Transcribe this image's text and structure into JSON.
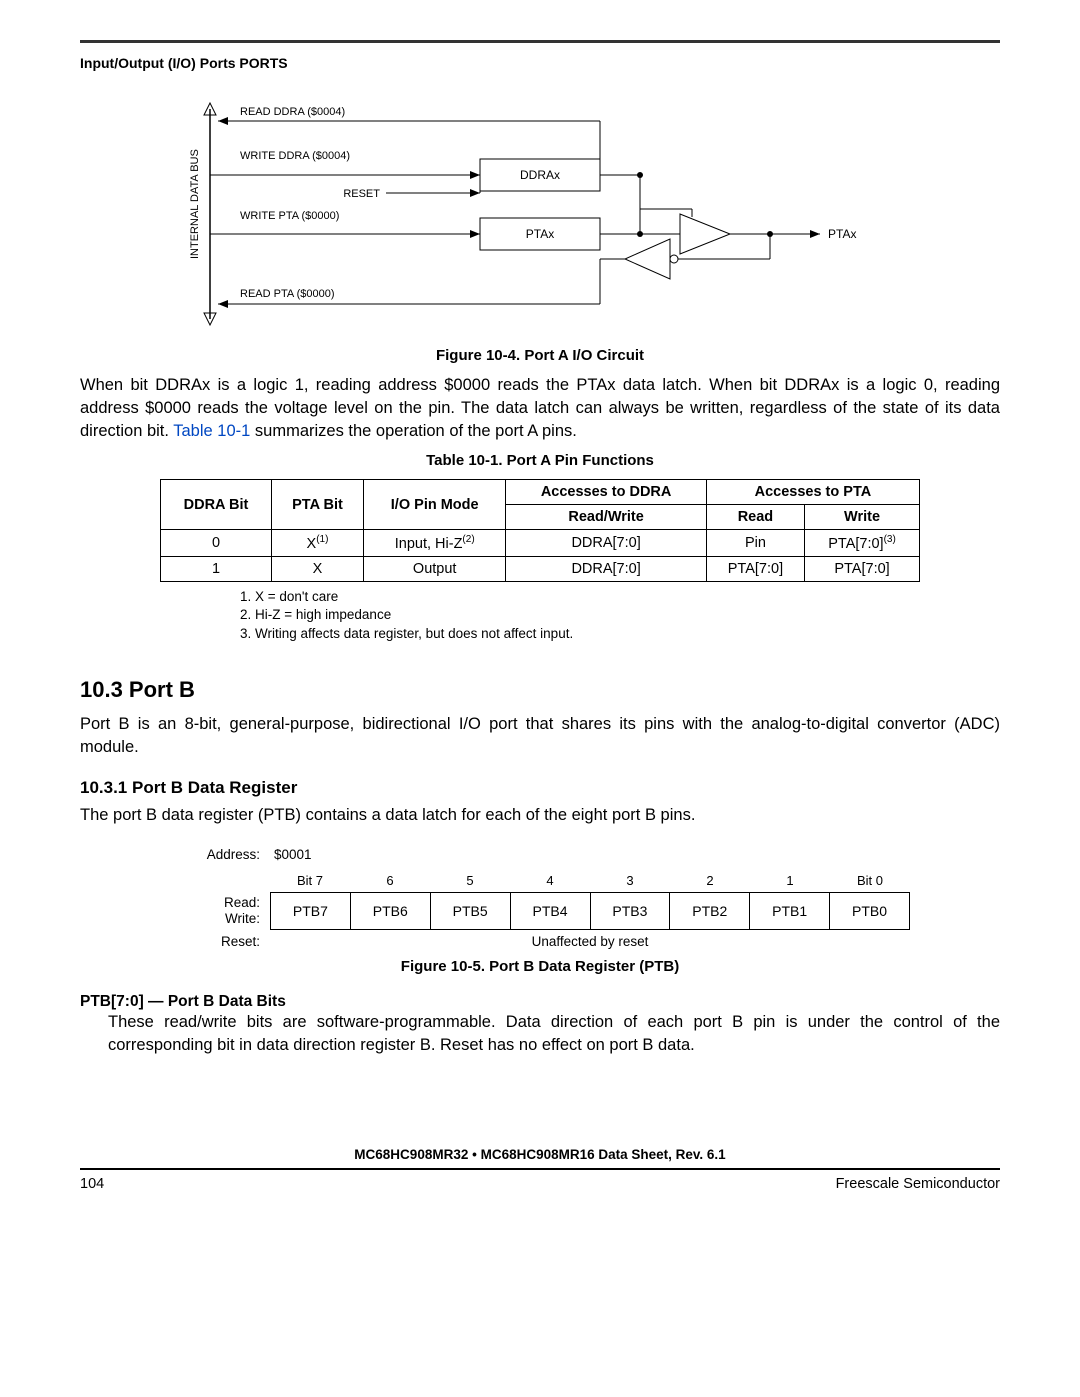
{
  "header": {
    "title": "Input/Output (I/O) Ports PORTS"
  },
  "diagram": {
    "bus_label": "INTERNAL DATA BUS",
    "read_ddra": "READ DDRA ($0004)",
    "write_ddra": "WRITE DDRA ($0004)",
    "reset": "RESET",
    "ddrax": "DDRAx",
    "write_pta": "WRITE PTA ($0000)",
    "ptax_box": "PTAx",
    "ptax_pin": "PTAx",
    "read_pta": "READ PTA ($0000)"
  },
  "fig4_caption": "Figure 10-4. Port A I/O Circuit",
  "para1": "When bit DDRAx is a logic 1, reading address $0000 reads the PTAx data latch. When bit DDRAx is a logic 0, reading address $0000 reads the voltage level on the pin. The data latch can always be written, regardless of the state of its data direction bit. ",
  "para1_link": "Table 10-1",
  "para1_after": " summarizes the operation of the port A pins.",
  "tab1_caption": "Table 10-1. Port A Pin Functions",
  "table1": {
    "h_ddra": "DDRA Bit",
    "h_pta": "PTA Bit",
    "h_mode": "I/O Pin Mode",
    "h_acc_ddra": "Accesses to DDRA",
    "h_acc_pta": "Accesses to PTA",
    "h_rw": "Read/Write",
    "h_read": "Read",
    "h_write": "Write",
    "rows": [
      {
        "ddra": "0",
        "pta": "X",
        "mode": "Input, Hi-Z",
        "rw": "DDRA[7:0]",
        "read": "Pin",
        "write": "PTA[7:0]"
      },
      {
        "ddra": "1",
        "pta": "X",
        "mode": "Output",
        "rw": "DDRA[7:0]",
        "read": "PTA[7:0]",
        "write": "PTA[7:0]"
      }
    ]
  },
  "notes": {
    "n1": "1. X = don't care",
    "n2": "2. Hi-Z = high impedance",
    "n3": "3. Writing affects data register, but does not affect input."
  },
  "sec_portb": "10.3  Port B",
  "portb_para": "Port B is an 8-bit, general-purpose, bidirectional I/O port that shares its pins with the analog-to-digital convertor (ADC) module.",
  "subsec_ptb": "10.3.1  Port B Data Register",
  "ptb_para": "The port B data register (PTB) contains a data latch for each of the eight port B pins.",
  "reg": {
    "address_label": "Address:",
    "address_value": "$0001",
    "bit_labels": [
      "Bit 7",
      "6",
      "5",
      "4",
      "3",
      "2",
      "1",
      "Bit 0"
    ],
    "rw_label_read": "Read:",
    "rw_label_write": "Write:",
    "cells": [
      "PTB7",
      "PTB6",
      "PTB5",
      "PTB4",
      "PTB3",
      "PTB2",
      "PTB1",
      "PTB0"
    ],
    "reset_label": "Reset:",
    "reset_text": "Unaffected by reset"
  },
  "fig5_caption": "Figure 10-5. Port B Data Register (PTB)",
  "bitdesc": {
    "title": "PTB[7:0] — Port B Data Bits",
    "body": "These read/write bits are software-programmable. Data direction of each port B pin is under the control of the corresponding bit in data direction register B. Reset has no effect on port B data."
  },
  "footer": {
    "title": "MC68HC908MR32 • MC68HC908MR16 Data Sheet, Rev. 6.1",
    "page": "104",
    "vendor": "Freescale Semiconductor"
  }
}
